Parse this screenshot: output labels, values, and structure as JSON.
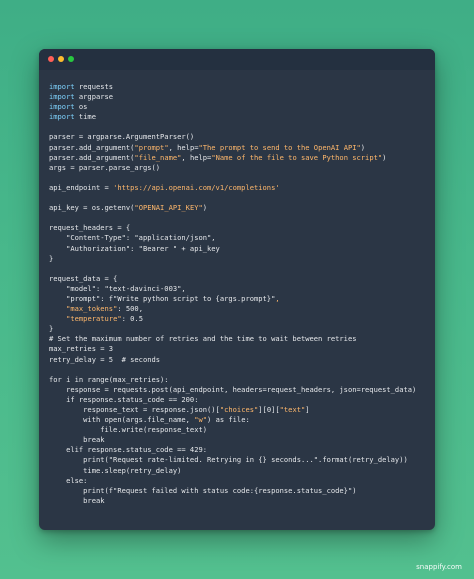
{
  "window": {
    "dots": [
      "close",
      "minimize",
      "maximize"
    ]
  },
  "code_lines": [
    [
      {
        "t": "import",
        "c": "kw"
      },
      {
        "t": " requests",
        "c": "plain"
      }
    ],
    [
      {
        "t": "import",
        "c": "kw"
      },
      {
        "t": " argparse",
        "c": "plain"
      }
    ],
    [
      {
        "t": "import",
        "c": "kw"
      },
      {
        "t": " os",
        "c": "plain"
      }
    ],
    [
      {
        "t": "import",
        "c": "kw"
      },
      {
        "t": " time",
        "c": "plain"
      }
    ],
    [],
    [
      {
        "t": "parser = argparse.ArgumentParser()",
        "c": "plain"
      }
    ],
    [
      {
        "t": "parser.add_argument(",
        "c": "plain"
      },
      {
        "t": "\"prompt\"",
        "c": "st"
      },
      {
        "t": ", help=",
        "c": "plain"
      },
      {
        "t": "\"The prompt to send to the OpenAI API\"",
        "c": "st"
      },
      {
        "t": ")",
        "c": "plain"
      }
    ],
    [
      {
        "t": "parser.add_argument(",
        "c": "plain"
      },
      {
        "t": "\"file_name\"",
        "c": "st"
      },
      {
        "t": ", help=",
        "c": "plain"
      },
      {
        "t": "\"Name of the file to save Python script\"",
        "c": "st"
      },
      {
        "t": ")",
        "c": "plain"
      }
    ],
    [
      {
        "t": "args = parser.parse_args()",
        "c": "plain"
      }
    ],
    [],
    [
      {
        "t": "api_endpoint = ",
        "c": "plain"
      },
      {
        "t": "'https://api.openai.com/v1/completions'",
        "c": "st"
      }
    ],
    [],
    [
      {
        "t": "api_key = os.getenv(",
        "c": "plain"
      },
      {
        "t": "\"OPENAI_API_KEY\"",
        "c": "st"
      },
      {
        "t": ")",
        "c": "plain"
      }
    ],
    [],
    [
      {
        "t": "request_headers = {",
        "c": "plain"
      }
    ],
    [
      {
        "t": "    \"Content-Type\": \"application/json\",",
        "c": "plain"
      }
    ],
    [
      {
        "t": "    \"Authorization\": \"Bearer \" + api_key",
        "c": "plain"
      }
    ],
    [
      {
        "t": "}",
        "c": "plain"
      }
    ],
    [],
    [
      {
        "t": "request_data = {",
        "c": "plain"
      }
    ],
    [
      {
        "t": "    \"model\": \"text-davinci-003\",",
        "c": "plain"
      }
    ],
    [
      {
        "t": "    \"prompt\": f\"Write python script to {args.prompt}\"",
        "c": "plain"
      },
      {
        "t": ",",
        "c": "st"
      }
    ],
    [
      {
        "t": "    ",
        "c": "plain"
      },
      {
        "t": "\"max_tokens\"",
        "c": "st"
      },
      {
        "t": ": 500,",
        "c": "plain"
      }
    ],
    [
      {
        "t": "    ",
        "c": "plain"
      },
      {
        "t": "\"temperature\"",
        "c": "st"
      },
      {
        "t": ": 0.5",
        "c": "plain"
      }
    ],
    [
      {
        "t": "}",
        "c": "plain"
      }
    ],
    [
      {
        "t": "# Set the maximum number of retries and the time to wait between retries",
        "c": "plain"
      }
    ],
    [
      {
        "t": "max_retries = 3",
        "c": "plain"
      }
    ],
    [
      {
        "t": "retry_delay = 5  # seconds",
        "c": "plain"
      }
    ],
    [],
    [
      {
        "t": "for i in range(max_retries):",
        "c": "plain"
      }
    ],
    [
      {
        "t": "    response = requests.post(api_endpoint, headers=request_headers, json=request_data)",
        "c": "plain"
      }
    ],
    [
      {
        "t": "    if response.status_code == 200:",
        "c": "plain"
      }
    ],
    [
      {
        "t": "        response_text = response.json()[",
        "c": "plain"
      },
      {
        "t": "\"choices\"",
        "c": "st"
      },
      {
        "t": "][0][",
        "c": "plain"
      },
      {
        "t": "\"text\"",
        "c": "st"
      },
      {
        "t": "]",
        "c": "plain"
      }
    ],
    [
      {
        "t": "        with open(args.file_name, ",
        "c": "plain"
      },
      {
        "t": "\"w\"",
        "c": "st"
      },
      {
        "t": ") as file:",
        "c": "plain"
      }
    ],
    [
      {
        "t": "            file.write(response_text)",
        "c": "plain"
      }
    ],
    [
      {
        "t": "        break",
        "c": "plain"
      }
    ],
    [
      {
        "t": "    elif response.status_code == 429:",
        "c": "plain"
      }
    ],
    [
      {
        "t": "        print(\"Request rate-limited. Retrying in {} seconds...\".format(retry_delay))",
        "c": "plain"
      }
    ],
    [
      {
        "t": "        time.sleep(retry_delay)",
        "c": "plain"
      }
    ],
    [
      {
        "t": "    else:",
        "c": "plain"
      }
    ],
    [
      {
        "t": "        print(f\"Request failed with status code:{response.status_code}\")",
        "c": "plain"
      }
    ],
    [
      {
        "t": "        break",
        "c": "plain"
      }
    ]
  ],
  "colors": {
    "background_top": "#3fae86",
    "background_bottom": "#53c08f",
    "window_bg": "#2b3645",
    "titlebar_bg": "#243040",
    "dot_close": "#ff5f57",
    "dot_minimize": "#febc2e",
    "dot_maximize": "#28c840",
    "keyword": "#7fd4ff",
    "string": "#ffb86c",
    "text": "#e6e8eb"
  },
  "watermark": "snappify.com"
}
